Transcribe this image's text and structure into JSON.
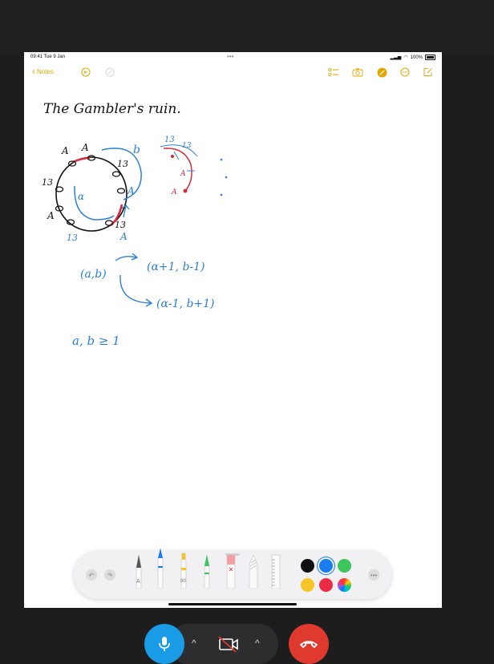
{
  "status_bar": {
    "time": "09:41  Tue 9 Jan",
    "more_dots": "•••",
    "battery": "100%"
  },
  "nav": {
    "back_label": "Notes",
    "icons": [
      "undo-circle-icon",
      "redo-circle-icon",
      "checklist-icon",
      "camera-icon",
      "markup-pen-icon",
      "more-circle-icon",
      "compose-icon"
    ]
  },
  "note": {
    "title": "The Gambler's ruin.",
    "circle_labels": {
      "a": "A",
      "b": "A",
      "c": "13",
      "d": "13",
      "e": "A",
      "f": "A",
      "g": "13",
      "h": "13",
      "i": "A",
      "inner": "α",
      "side": "b"
    },
    "small_labels": {
      "l1": "13",
      "l2": "13",
      "l3": "A",
      "l4": "A"
    },
    "eq_left": "(a,b)",
    "eq_up": "(α+1, b-1)",
    "eq_down": "(α-1, b+1)",
    "constraint": "a, b ≥ 1"
  },
  "toolbar": {
    "undo": "↶",
    "redo": "↷",
    "more": "•••",
    "pen_label": "A",
    "marker_label": "80",
    "swatch_colors": [
      "#111111",
      "#1a7ef2",
      "#3bc55a",
      "#f7c626",
      "#ea2b43"
    ]
  },
  "colors": {
    "accent": "#e0a800",
    "ink_black": "#111111",
    "ink_blue": "#2b7fd8",
    "ink_red": "#d8283c"
  },
  "call": {
    "mic": "microphone-icon",
    "video": "video-off-icon",
    "end": "end-call-icon"
  }
}
